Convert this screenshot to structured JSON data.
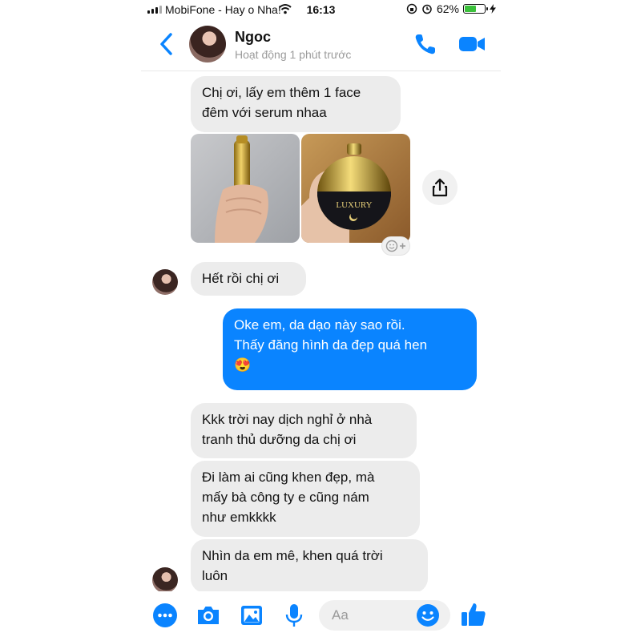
{
  "status_bar": {
    "carrier": "MobiFone - Hay o Nha!",
    "time": "16:13",
    "battery": "62%",
    "battery_level": 0.62
  },
  "header": {
    "contact_name": "Ngoc",
    "contact_status": "Hoạt động 1 phút trước",
    "back_icon": "chevron-left-icon",
    "call_icon": "phone-icon",
    "video_icon": "video-camera-icon"
  },
  "messages": [
    {
      "from": "contact",
      "text": "Chị ơi, lấy em thêm 1 face\nđêm với serum nhaa"
    },
    {
      "from": "contact",
      "type": "photos",
      "photos": [
        "serum-bottle-photo",
        "luxury-night-cream-jar-photo"
      ]
    },
    {
      "from": "contact",
      "text": "Hết rồi chị ơi"
    },
    {
      "from": "me",
      "text": "Oke em, da dạo này sao rồi.\nThấy đăng hình da đẹp quá hen\n😍"
    },
    {
      "from": "contact",
      "text": "Kkk trời nay dịch nghỉ ở nhà\ntranh thủ dưỡng da chị ơi"
    },
    {
      "from": "contact",
      "text": "Đi làm ai cũng khen đẹp, mà\nmấy bà công ty e cũng nám\nnhư emkkkk"
    },
    {
      "from": "contact",
      "text": "Nhìn da em mê, khen quá trời\nluôn"
    }
  ],
  "photo_jar_label": "LUXURY",
  "composer": {
    "placeholder": "Aa",
    "icons": [
      "more-icon",
      "camera-icon",
      "gallery-icon",
      "microphone-icon",
      "emoji-icon",
      "thumbs-up-icon"
    ]
  },
  "colors": {
    "accent": "#0a84ff",
    "incoming_bubble": "#ececec",
    "battery_green": "#3bc13b"
  }
}
